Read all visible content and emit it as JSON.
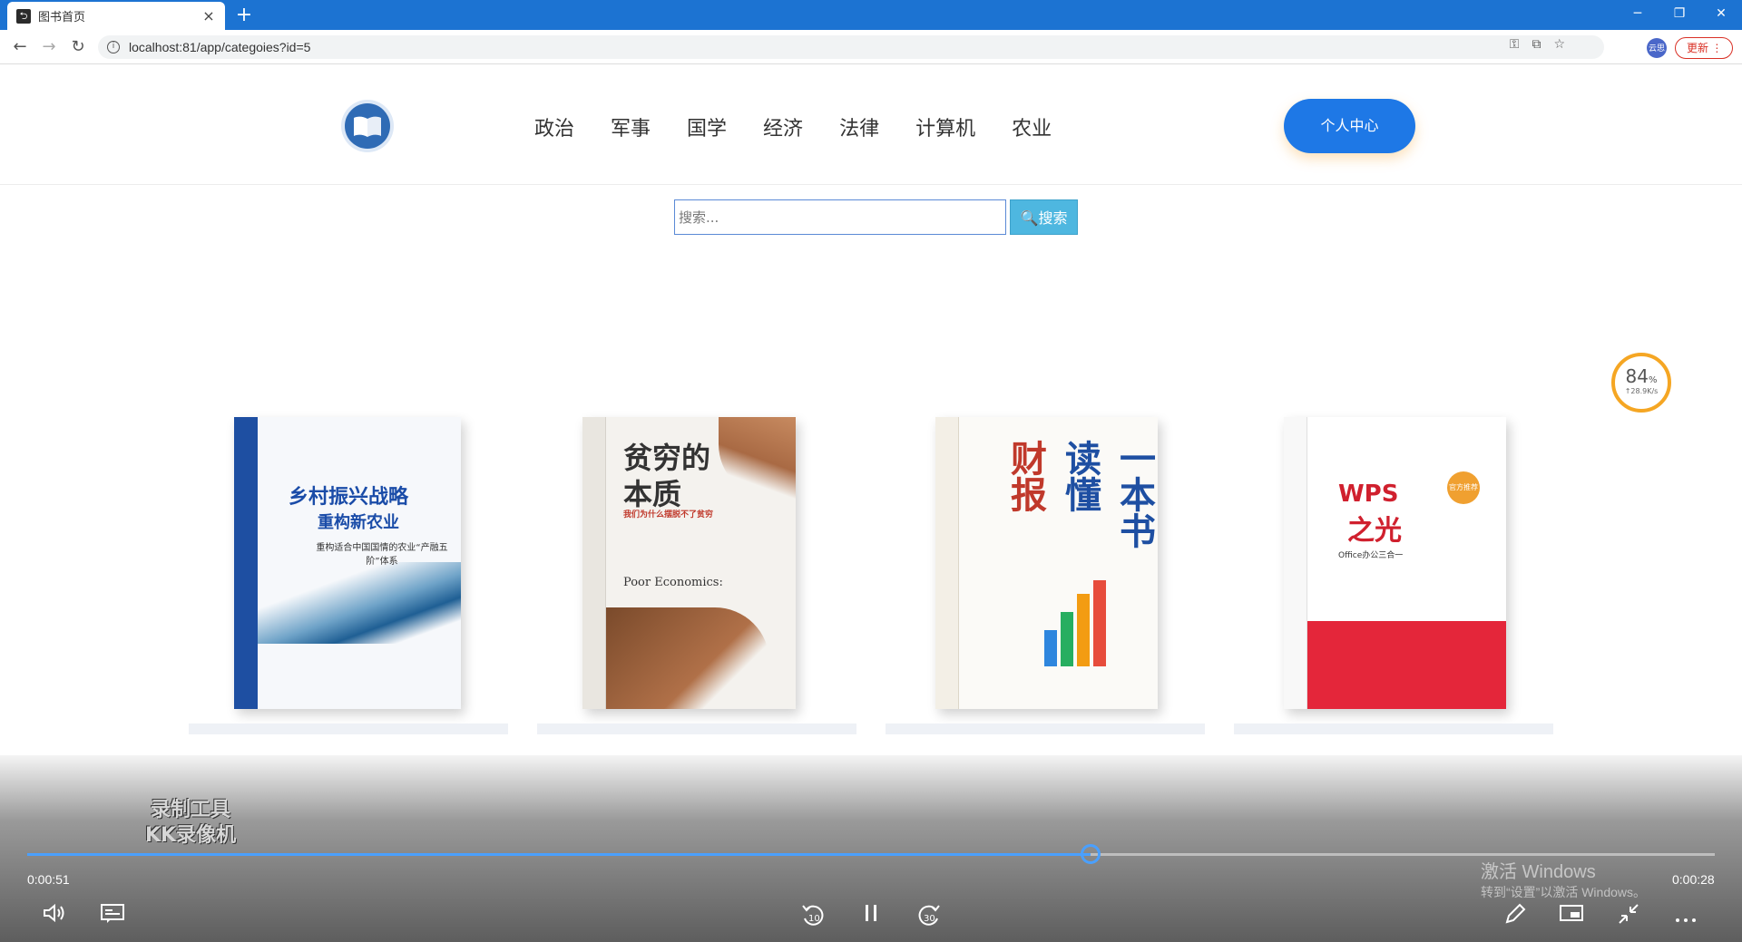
{
  "browser": {
    "tab_title": "图书首页",
    "tab_close": "×",
    "new_tab": "+",
    "url": "localhost:81/app/categoies?id=5",
    "update_label": "更新",
    "profile_label": "云思",
    "win_min": "─",
    "win_restore": "❐",
    "win_close": "✕",
    "back": "←",
    "forward": "→",
    "reload": "↻"
  },
  "header": {
    "nav": [
      "政治",
      "军事",
      "国学",
      "经济",
      "法律",
      "计算机",
      "农业"
    ],
    "center_button": "个人中心"
  },
  "search": {
    "placeholder": "搜索...",
    "button_label": "🔍搜索"
  },
  "speed_widget": {
    "percent": "84",
    "percent_unit": "%",
    "rate": "↑28.9K/s"
  },
  "books": [
    {
      "title": "乡村振兴战略",
      "subtitle": "重构新农业",
      "note": "重构适合中国国情的农业“产融五阶”体系"
    },
    {
      "title_line1": "贫穷的",
      "title_line2": "本质",
      "note": "我们为什么摆脱不了贫穷",
      "english": "Poor Economics:"
    },
    {
      "chars": [
        "财报",
        "读懂",
        "一本书"
      ]
    },
    {
      "title_line1": "WPS",
      "title_line2": "之光",
      "note": "Office办公三合一",
      "badge": "官方推荐"
    }
  ],
  "player": {
    "elapsed": "0:00:51",
    "remaining": "0:00:28",
    "progress": 0.63,
    "watermark_line1": "录制工具",
    "watermark_line2": "KK录像机",
    "activate_line1": "激活 Windows",
    "activate_line2": "转到“设置”以激活 Windows。"
  },
  "icons": {
    "volume": "volume-icon",
    "captions": "captions-icon",
    "rewind": "rewind-10-icon",
    "pause": "pause-icon",
    "forward": "forward-30-icon",
    "edit": "pen-icon",
    "miniview": "miniview-icon",
    "fullscreen": "exit-fullscreen-icon",
    "more": "more-icon"
  },
  "colors": {
    "title_bar": "#1c73d2",
    "accent_button": "#1e78e6",
    "search_button": "#4eb7e0",
    "progress": "#4aa0ff"
  }
}
